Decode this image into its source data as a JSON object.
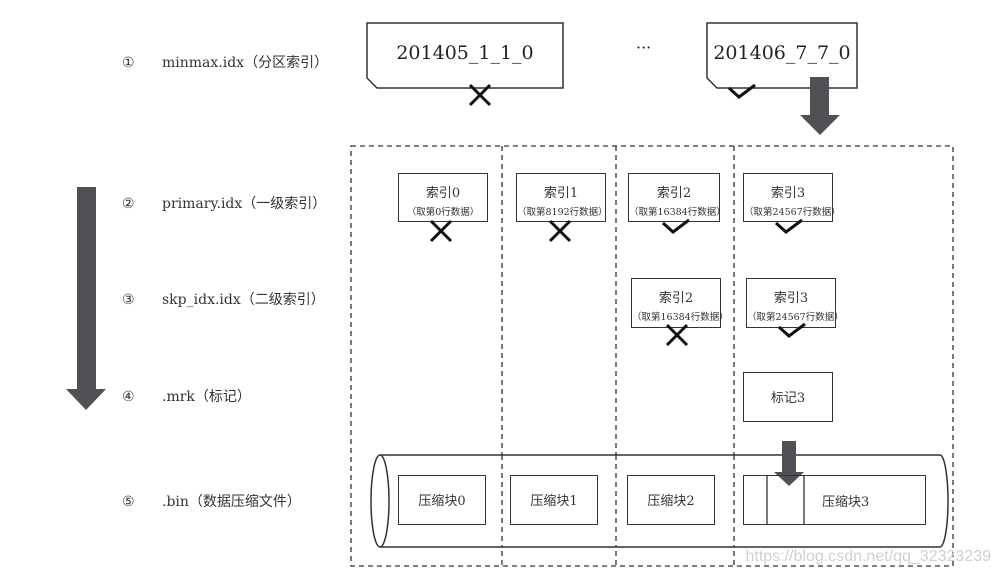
{
  "levels": [
    {
      "num": "①",
      "text": "minmax.idx（分区索引）"
    },
    {
      "num": "②",
      "text": "primary.idx（一级索引）"
    },
    {
      "num": "③",
      "text": "skp_idx.idx（二级索引）"
    },
    {
      "num": "④",
      "text": ".mrk（标记）"
    },
    {
      "num": "⑤",
      "text": ".bin（数据压缩文件）"
    }
  ],
  "partitions": [
    {
      "name": "201405_1_1_0",
      "result": "cross"
    },
    {
      "name": "201406_7_7_0",
      "result": "check"
    }
  ],
  "ellipsis": "···",
  "primary_index": [
    {
      "title": "索引0",
      "sub": "（取第0行数据）",
      "result": "cross"
    },
    {
      "title": "索引1",
      "sub": "（取第8192行数据）",
      "result": "cross"
    },
    {
      "title": "索引2",
      "sub": "（取第16384行数据）",
      "result": "check"
    },
    {
      "title": "索引3",
      "sub": "（取第24567行数据）",
      "result": "check"
    }
  ],
  "skip_index": [
    {
      "title": "索引2",
      "sub": "（取第16384行数据）",
      "result": "cross"
    },
    {
      "title": "索引3",
      "sub": "（取第24567行数据）",
      "result": "check"
    }
  ],
  "mark": {
    "label": "标记3"
  },
  "blocks": [
    "压缩块0",
    "压缩块1",
    "压缩块2",
    "压缩块3"
  ],
  "watermark": "https://blog.csdn.net/qq_32323239",
  "colors": {
    "arrow": "#505055",
    "line": "#333333"
  }
}
